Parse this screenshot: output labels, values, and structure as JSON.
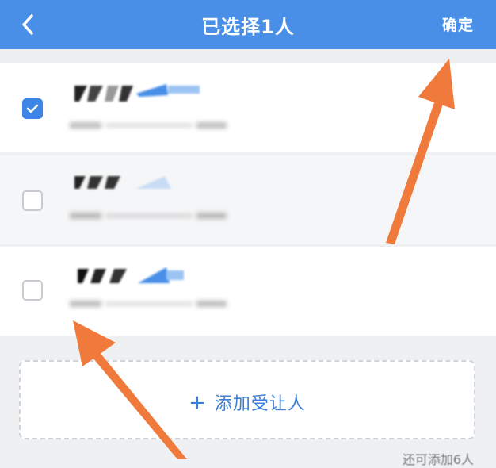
{
  "header": {
    "title": "已选择1人",
    "confirm_label": "确定",
    "back_icon": "chevron-left-icon",
    "background": "#4a8fe7"
  },
  "rows": [
    {
      "checked": true
    },
    {
      "checked": false
    },
    {
      "checked": false
    }
  ],
  "add_button": {
    "plus": "+",
    "label": "添加受让人"
  },
  "remaining_hint": "还可添加6人",
  "colors": {
    "accent": "#3d86e5",
    "annotation_arrow": "#f07a3c"
  }
}
